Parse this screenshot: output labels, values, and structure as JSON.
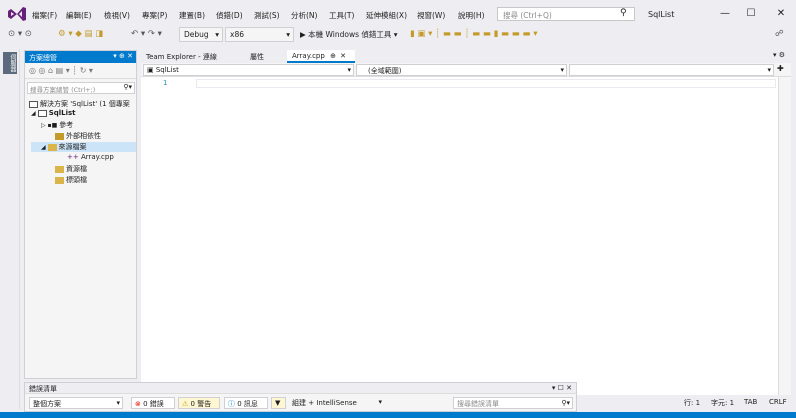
{
  "menubar": {
    "items": [
      "檔案(F)",
      "編輯(E)",
      "檢視(V)",
      "專案(P)",
      "建置(B)",
      "偵錯(D)",
      "測試(S)",
      "分析(N)",
      "工具(T)",
      "延伸模組(X)",
      "視窗(W)",
      "說明(H)"
    ],
    "search_placeholder": "搜尋 (Ctrl+Q)",
    "solution_title": "SqlList"
  },
  "toolbar": {
    "config": "Debug",
    "platform": "x86",
    "run_label": "▶ 本機 Windows 偵錯工具 ▾"
  },
  "sidestrip": {
    "label": "伺服器"
  },
  "solution_explorer": {
    "title": "方案總管",
    "search_placeholder": "搜尋方案總管 (Ctrl+;)",
    "tree": [
      {
        "label": "解決方案 'SqlList' (1 個專案",
        "indent": 0
      },
      {
        "label": "SqlList",
        "indent": 1
      },
      {
        "label": "參考",
        "indent": 2
      },
      {
        "label": "外部相依性",
        "indent": 3
      },
      {
        "label": "來源檔案",
        "indent": 2
      },
      {
        "label": "Array.cpp",
        "indent": 4
      },
      {
        "label": "資源檔",
        "indent": 3
      },
      {
        "label": "標頭檔",
        "indent": 3
      }
    ]
  },
  "editor": {
    "tabs": [
      {
        "label": "Team Explorer - 連線",
        "active": false
      },
      {
        "label": "屬性",
        "active": false
      },
      {
        "label": "Array.cpp",
        "active": true
      }
    ],
    "nav_left": "SqlList",
    "nav_mid": "(全域範圍)",
    "line_number": "1"
  },
  "error_list": {
    "title": "錯誤清單",
    "scope": "整個方案",
    "errors": "0 錯誤",
    "warnings": "0 警告",
    "messages": "0 訊息",
    "build_filter": "組建 + IntelliSense",
    "search_placeholder": "搜尋錯誤清單"
  },
  "status": {
    "line": "行: 1",
    "char": "字元: 1",
    "tab": "TAB",
    "eol": "CRLF"
  },
  "colors": {
    "accent": "#007acc",
    "vs_purple": "#68217a"
  }
}
